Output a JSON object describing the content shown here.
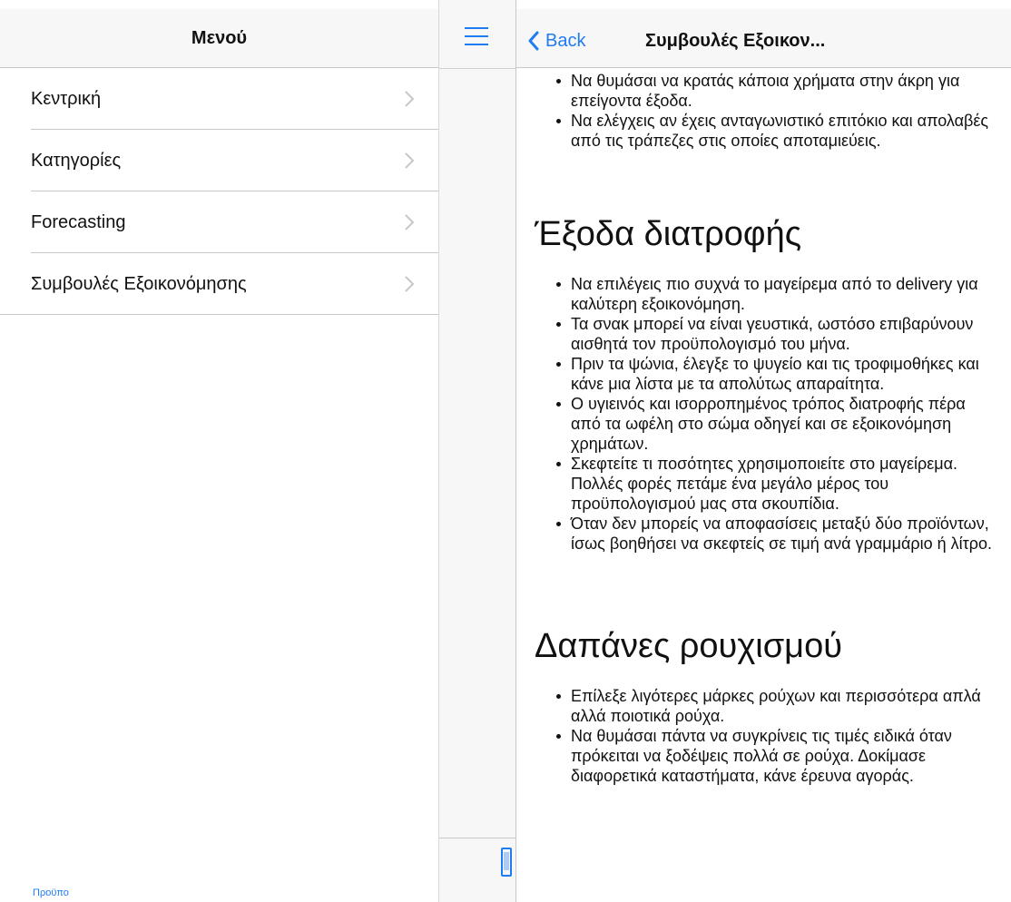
{
  "menu": {
    "title": "Μενού",
    "items": [
      {
        "label": "Κεντρική"
      },
      {
        "label": "Κατηγορίες"
      },
      {
        "label": "Forecasting"
      },
      {
        "label": "Συμβουλές Εξοικονόμησης"
      }
    ]
  },
  "tabbar": {
    "label": "Προϋπο"
  },
  "nav": {
    "back_label": "Back",
    "title": "Συμβουλές Εξοικον..."
  },
  "article": {
    "section1": {
      "bullets": [
        "Να θυμάσαι να κρατάς κάποια χρήματα στην άκρη για επείγοντα έξοδα.",
        "Να ελέγχεις αν έχεις ανταγωνιστικό επιτόκιο και απολαβές από τις τράπεζες στις οποίες αποταμιεύεις."
      ]
    },
    "section2": {
      "heading": "Έξοδα διατροφής",
      "bullets": [
        "Να επιλέγεις πιο συχνά το μαγείρεμα από το delivery για καλύτερη εξοικονόμηση.",
        "Τα σνακ μπορεί να είναι γευστικά, ωστόσο επιβαρύνουν αισθητά τον προϋπολογισμό του μήνα.",
        "Πριν τα ψώνια, έλεγξε το ψυγείο και τις τροφιμοθήκες και κάνε μια λίστα με τα απολύτως απαραίτητα.",
        "Ο υγιεινός και ισορροπημένος τρόπος διατροφής πέρα από τα ωφέλη στο σώμα οδηγεί και σε εξοικονόμηση χρημάτων.",
        "Σκεφτείτε τι ποσότητες χρησιμοποιείτε στο μαγείρεμα. Πολλές φορές πετάμε ένα μεγάλο μέρος του προϋπολογισμού μας στα σκουπίδια.",
        "Όταν δεν μπορείς να αποφασίσεις μεταξύ δύο προϊόντων, ίσως βοηθήσει να σκεφτείς σε τιμή ανά γραμμάριο ή λίτρο."
      ]
    },
    "section3": {
      "heading": "Δαπάνες ρουχισμού",
      "bullets": [
        "Επίλεξε λιγότερες μάρκες ρούχων και περισσότερα απλά αλλά ποιοτικά ρούχα.",
        "Να θυμάσαι πάντα να συγκρίνεις τις τιμές ειδικά όταν πρόκειται να ξοδέψεις πολλά σε ρούχα. Δοκίμασε διαφορετικά καταστήματα, κάνε έρευνα αγοράς."
      ]
    }
  },
  "icons": {
    "hamburger": "hamburger-menu-icon",
    "back": "chevron-left-icon",
    "disclosure": "chevron-right-icon",
    "tab": "phone-icon"
  },
  "colors": {
    "accent": "#1f7cf2",
    "bar_bg": "#f7f7f7",
    "separator": "#c8c8cc",
    "chevron": "#c7c7cc"
  }
}
